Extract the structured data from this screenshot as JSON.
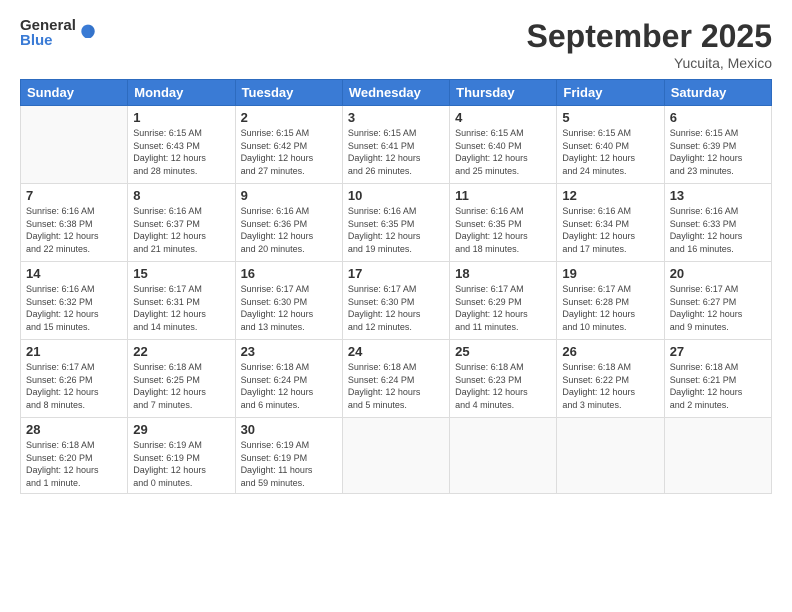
{
  "logo": {
    "general": "General",
    "blue": "Blue"
  },
  "title": "September 2025",
  "location": "Yucuita, Mexico",
  "days_of_week": [
    "Sunday",
    "Monday",
    "Tuesday",
    "Wednesday",
    "Thursday",
    "Friday",
    "Saturday"
  ],
  "weeks": [
    [
      {
        "day": "",
        "info": ""
      },
      {
        "day": "1",
        "info": "Sunrise: 6:15 AM\nSunset: 6:43 PM\nDaylight: 12 hours\nand 28 minutes."
      },
      {
        "day": "2",
        "info": "Sunrise: 6:15 AM\nSunset: 6:42 PM\nDaylight: 12 hours\nand 27 minutes."
      },
      {
        "day": "3",
        "info": "Sunrise: 6:15 AM\nSunset: 6:41 PM\nDaylight: 12 hours\nand 26 minutes."
      },
      {
        "day": "4",
        "info": "Sunrise: 6:15 AM\nSunset: 6:40 PM\nDaylight: 12 hours\nand 25 minutes."
      },
      {
        "day": "5",
        "info": "Sunrise: 6:15 AM\nSunset: 6:40 PM\nDaylight: 12 hours\nand 24 minutes."
      },
      {
        "day": "6",
        "info": "Sunrise: 6:15 AM\nSunset: 6:39 PM\nDaylight: 12 hours\nand 23 minutes."
      }
    ],
    [
      {
        "day": "7",
        "info": "Sunrise: 6:16 AM\nSunset: 6:38 PM\nDaylight: 12 hours\nand 22 minutes."
      },
      {
        "day": "8",
        "info": "Sunrise: 6:16 AM\nSunset: 6:37 PM\nDaylight: 12 hours\nand 21 minutes."
      },
      {
        "day": "9",
        "info": "Sunrise: 6:16 AM\nSunset: 6:36 PM\nDaylight: 12 hours\nand 20 minutes."
      },
      {
        "day": "10",
        "info": "Sunrise: 6:16 AM\nSunset: 6:35 PM\nDaylight: 12 hours\nand 19 minutes."
      },
      {
        "day": "11",
        "info": "Sunrise: 6:16 AM\nSunset: 6:35 PM\nDaylight: 12 hours\nand 18 minutes."
      },
      {
        "day": "12",
        "info": "Sunrise: 6:16 AM\nSunset: 6:34 PM\nDaylight: 12 hours\nand 17 minutes."
      },
      {
        "day": "13",
        "info": "Sunrise: 6:16 AM\nSunset: 6:33 PM\nDaylight: 12 hours\nand 16 minutes."
      }
    ],
    [
      {
        "day": "14",
        "info": "Sunrise: 6:16 AM\nSunset: 6:32 PM\nDaylight: 12 hours\nand 15 minutes."
      },
      {
        "day": "15",
        "info": "Sunrise: 6:17 AM\nSunset: 6:31 PM\nDaylight: 12 hours\nand 14 minutes."
      },
      {
        "day": "16",
        "info": "Sunrise: 6:17 AM\nSunset: 6:30 PM\nDaylight: 12 hours\nand 13 minutes."
      },
      {
        "day": "17",
        "info": "Sunrise: 6:17 AM\nSunset: 6:30 PM\nDaylight: 12 hours\nand 12 minutes."
      },
      {
        "day": "18",
        "info": "Sunrise: 6:17 AM\nSunset: 6:29 PM\nDaylight: 12 hours\nand 11 minutes."
      },
      {
        "day": "19",
        "info": "Sunrise: 6:17 AM\nSunset: 6:28 PM\nDaylight: 12 hours\nand 10 minutes."
      },
      {
        "day": "20",
        "info": "Sunrise: 6:17 AM\nSunset: 6:27 PM\nDaylight: 12 hours\nand 9 minutes."
      }
    ],
    [
      {
        "day": "21",
        "info": "Sunrise: 6:17 AM\nSunset: 6:26 PM\nDaylight: 12 hours\nand 8 minutes."
      },
      {
        "day": "22",
        "info": "Sunrise: 6:18 AM\nSunset: 6:25 PM\nDaylight: 12 hours\nand 7 minutes."
      },
      {
        "day": "23",
        "info": "Sunrise: 6:18 AM\nSunset: 6:24 PM\nDaylight: 12 hours\nand 6 minutes."
      },
      {
        "day": "24",
        "info": "Sunrise: 6:18 AM\nSunset: 6:24 PM\nDaylight: 12 hours\nand 5 minutes."
      },
      {
        "day": "25",
        "info": "Sunrise: 6:18 AM\nSunset: 6:23 PM\nDaylight: 12 hours\nand 4 minutes."
      },
      {
        "day": "26",
        "info": "Sunrise: 6:18 AM\nSunset: 6:22 PM\nDaylight: 12 hours\nand 3 minutes."
      },
      {
        "day": "27",
        "info": "Sunrise: 6:18 AM\nSunset: 6:21 PM\nDaylight: 12 hours\nand 2 minutes."
      }
    ],
    [
      {
        "day": "28",
        "info": "Sunrise: 6:18 AM\nSunset: 6:20 PM\nDaylight: 12 hours\nand 1 minute."
      },
      {
        "day": "29",
        "info": "Sunrise: 6:19 AM\nSunset: 6:19 PM\nDaylight: 12 hours\nand 0 minutes."
      },
      {
        "day": "30",
        "info": "Sunrise: 6:19 AM\nSunset: 6:19 PM\nDaylight: 11 hours\nand 59 minutes."
      },
      {
        "day": "",
        "info": ""
      },
      {
        "day": "",
        "info": ""
      },
      {
        "day": "",
        "info": ""
      },
      {
        "day": "",
        "info": ""
      }
    ]
  ]
}
